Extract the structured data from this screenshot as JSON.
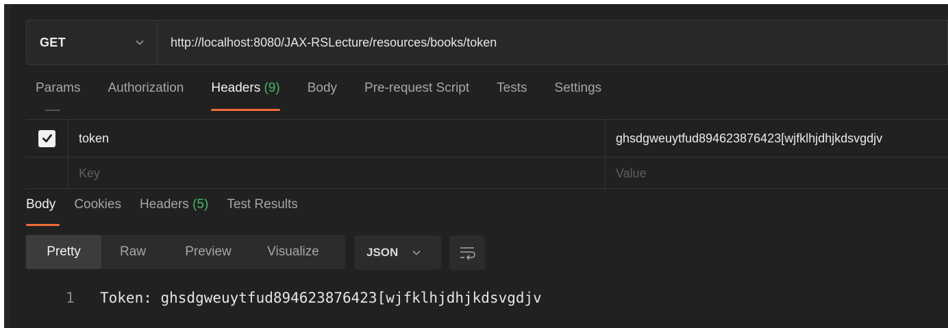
{
  "request": {
    "method": "GET",
    "url": "http://localhost:8080/JAX-RSLecture/resources/books/token"
  },
  "request_tabs": [
    {
      "label": "Params",
      "count": ""
    },
    {
      "label": "Authorization",
      "count": ""
    },
    {
      "label": "Headers",
      "count": "(9)",
      "active": true
    },
    {
      "label": "Body",
      "count": ""
    },
    {
      "label": "Pre-request Script",
      "count": ""
    },
    {
      "label": "Tests",
      "count": ""
    },
    {
      "label": "Settings",
      "count": ""
    }
  ],
  "headers_table": {
    "rows": [
      {
        "checked": true,
        "key": "token",
        "value": "ghsdgweuytfud894623876423[wjfklhjdhjkdsvgdjv"
      }
    ],
    "key_placeholder": "Key",
    "value_placeholder": "Value"
  },
  "response_tabs": [
    {
      "label": "Body",
      "count": "",
      "active": true
    },
    {
      "label": "Cookies",
      "count": ""
    },
    {
      "label": "Headers",
      "count": "(5)"
    },
    {
      "label": "Test Results",
      "count": ""
    }
  ],
  "view_modes": [
    "Pretty",
    "Raw",
    "Preview",
    "Visualize"
  ],
  "active_view": "Pretty",
  "language": "JSON",
  "response_body": [
    {
      "line": "1",
      "text": "Token: ghsdgweuytfud894623876423[wjfklhjdhjkdsvgdjv"
    }
  ],
  "colors": {
    "accent": "#f26b3a",
    "count": "#49b86d",
    "background": "#212121"
  },
  "icons": {
    "method_dropdown": "chevron-down-icon",
    "checkbox": "checkmark-icon",
    "language_dropdown": "chevron-down-icon",
    "wrap": "wrap-lines-icon"
  }
}
